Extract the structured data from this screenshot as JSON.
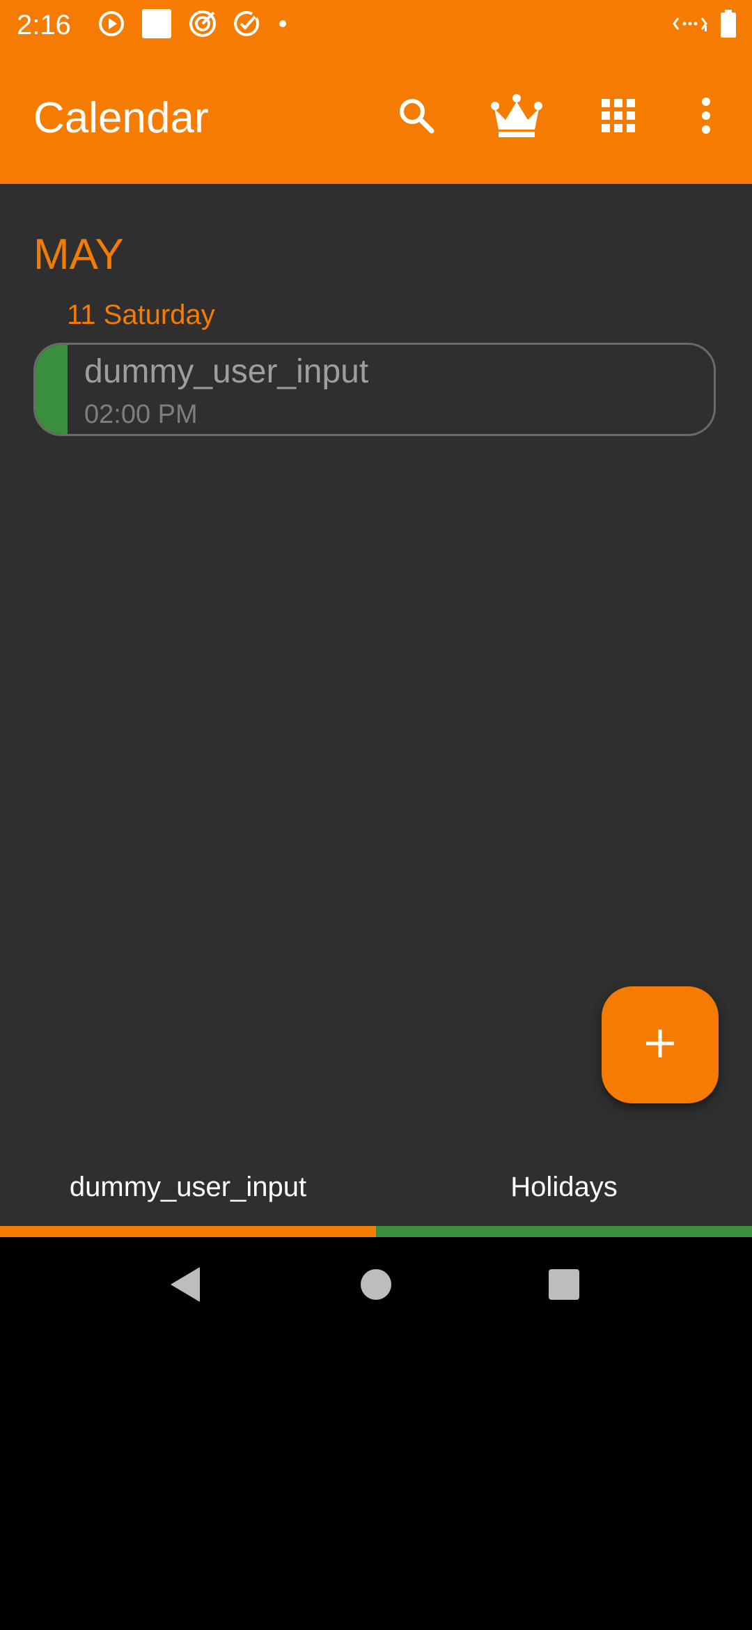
{
  "status_bar": {
    "time": "2:16",
    "left_icons": [
      "play-circle-icon",
      "square-icon",
      "target-icon",
      "check-circle-icon",
      "dot-icon"
    ],
    "right_icons": [
      "data-signal-icon",
      "battery-icon"
    ]
  },
  "app_bar": {
    "title": "Calendar",
    "actions": [
      "search-icon",
      "crown-icon",
      "grid-icon",
      "more-vert-icon"
    ],
    "background": "#F57C00"
  },
  "agenda": {
    "month": "MAY",
    "day": "11 Saturday",
    "events": [
      {
        "title": "dummy_user_input",
        "time": "02:00 PM",
        "color": "#3A8F3E"
      }
    ]
  },
  "fab": {
    "icon": "plus-icon"
  },
  "tabs": [
    {
      "label": "dummy_user_input",
      "color": "#F57C00"
    },
    {
      "label": "Holidays",
      "color": "#3A8F3E"
    }
  ],
  "nav_bar": {
    "buttons": [
      "back-icon",
      "home-icon",
      "recents-icon"
    ]
  }
}
